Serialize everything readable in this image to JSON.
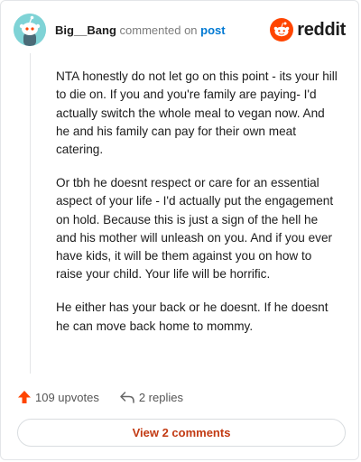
{
  "header": {
    "username": "Big__Bang",
    "commented_text": "commented on",
    "post_link": "post",
    "brand": "reddit"
  },
  "comment": {
    "paragraphs": [
      "NTA honestly do not let go on this point - its your hill to die on. If you and you're family are paying- I'd actually switch the whole meal to vegan now. And he and his family can pay for their own meat catering.",
      "Or tbh he doesnt respect or care for an essential aspect of your life - I'd actually put the engagement on hold. Because this is just a sign of the hell he and his mother will unleash on you. And if you ever have kids, it will be them against you on how to raise your child. Your life will be horrific.",
      "He either has your back or he doesnt. If he doesnt he can move back home to mommy."
    ]
  },
  "actions": {
    "upvotes": "109 upvotes",
    "replies": "2 replies"
  },
  "view_button": "View 2 comments",
  "colors": {
    "upvote": "#ff4500",
    "brand": "#ff4500",
    "link": "#0079d3",
    "view_button_text": "#c23a13",
    "avatar_bg": "#7fd3d6"
  },
  "icons": {
    "avatar": "snoo-avatar",
    "brand": "reddit-logo",
    "upvote": "upvote-arrow-icon",
    "reply": "reply-arrow-icon"
  }
}
